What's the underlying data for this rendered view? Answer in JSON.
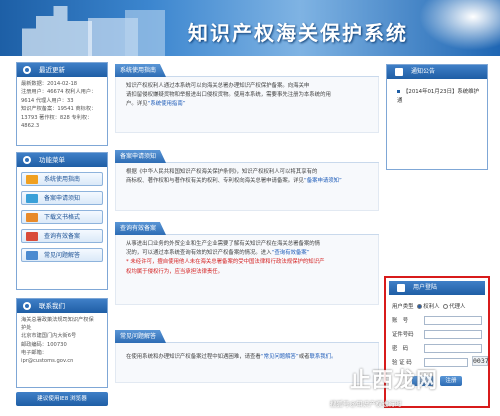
{
  "header": {
    "title": "知识产权海关保护系统"
  },
  "left": {
    "stats": {
      "title": "最近更新",
      "lines": [
        "最新数据：2014-02-18",
        "注册用户：46674 权利人用户：",
        "9614 代理人用户：33",
        "知识产权备案：19541 商标权：",
        "13793 著作权：828 专利权：",
        "4862.3"
      ]
    },
    "menu": {
      "title": "功能菜单",
      "items": [
        "系统使用指南",
        "备案申请须知",
        "下载文书格式",
        "查询有效备案",
        "常见问题解答"
      ]
    },
    "contact": {
      "title": "联系我们",
      "lines": [
        "海关总署政策法规司知识产权保",
        "护处",
        "北京市建国门内大街6号",
        "邮政编码：100730",
        "电子邮箱：",
        "ipr@customs.gov.cn"
      ]
    },
    "footer": "建议使用IE8 浏览器"
  },
  "sections": {
    "guide": {
      "title": "系统使用指南",
      "lines": [
        "知识产权权利人通过本系统可以向海关总署办理知识产权保护备案。向海关申",
        "请扣留侵权嫌疑货物和举报进出口侵权货物。使用本系统，需要事先注册为本系统的用",
        "户。详见"
      ],
      "link": "“系统使用指南”"
    },
    "apply": {
      "title": "备案申请须知",
      "lines": [
        "根据《中华人民共和国知识产权海关保护条例》，知识产权权利人可以将其享有的",
        "商标权、著作权和与著作权有关的权利、专利权向海关总署申请备案。详见"
      ],
      "link": "“备案申请须知”"
    },
    "query": {
      "title": "查询有效备案",
      "lines": [
        "从事进出口业务的外贸企业和生产企业需要了解有关知识产权在海关总署备案的情",
        "况的，可以通过本系统查询有效的知识产权备案的情况。进入"
      ],
      "link": "“查询有效备案”",
      "warn": [
        "* 未经许可，擅自使用他人未在海关总署备案的受中国法律和行政法规保护的知识产",
        "权均属于侵权行为，应当承担法律责任。"
      ]
    },
    "faq": {
      "title": "常见问题解答",
      "text": "在使用系统和办理知识产权备案过程中如遇困难，请查看",
      "link1": "“常见问题解答”",
      "mid": "或者",
      "link2": "联系我们。"
    }
  },
  "notice": {
    "title": "通知公告",
    "item": "【2014年01月23日】系统维护通"
  },
  "login": {
    "title": "用户登陆",
    "type_label": "用户类型",
    "opt1": "权利人",
    "opt2": "代理人",
    "f_account": "账　号",
    "f_id": "证件号码",
    "f_pwd": "密　码",
    "f_code": "验 证 码",
    "captcha": "0037",
    "login_btn": "登录",
    "register_btn": "注册"
  },
  "watermark": {
    "logo": "止西龙网",
    "sub": "搜狐号@知识产权进行时"
  },
  "colors": {
    "brand_blue": "#1f5ea5",
    "alert_red": "#d81b1b"
  }
}
